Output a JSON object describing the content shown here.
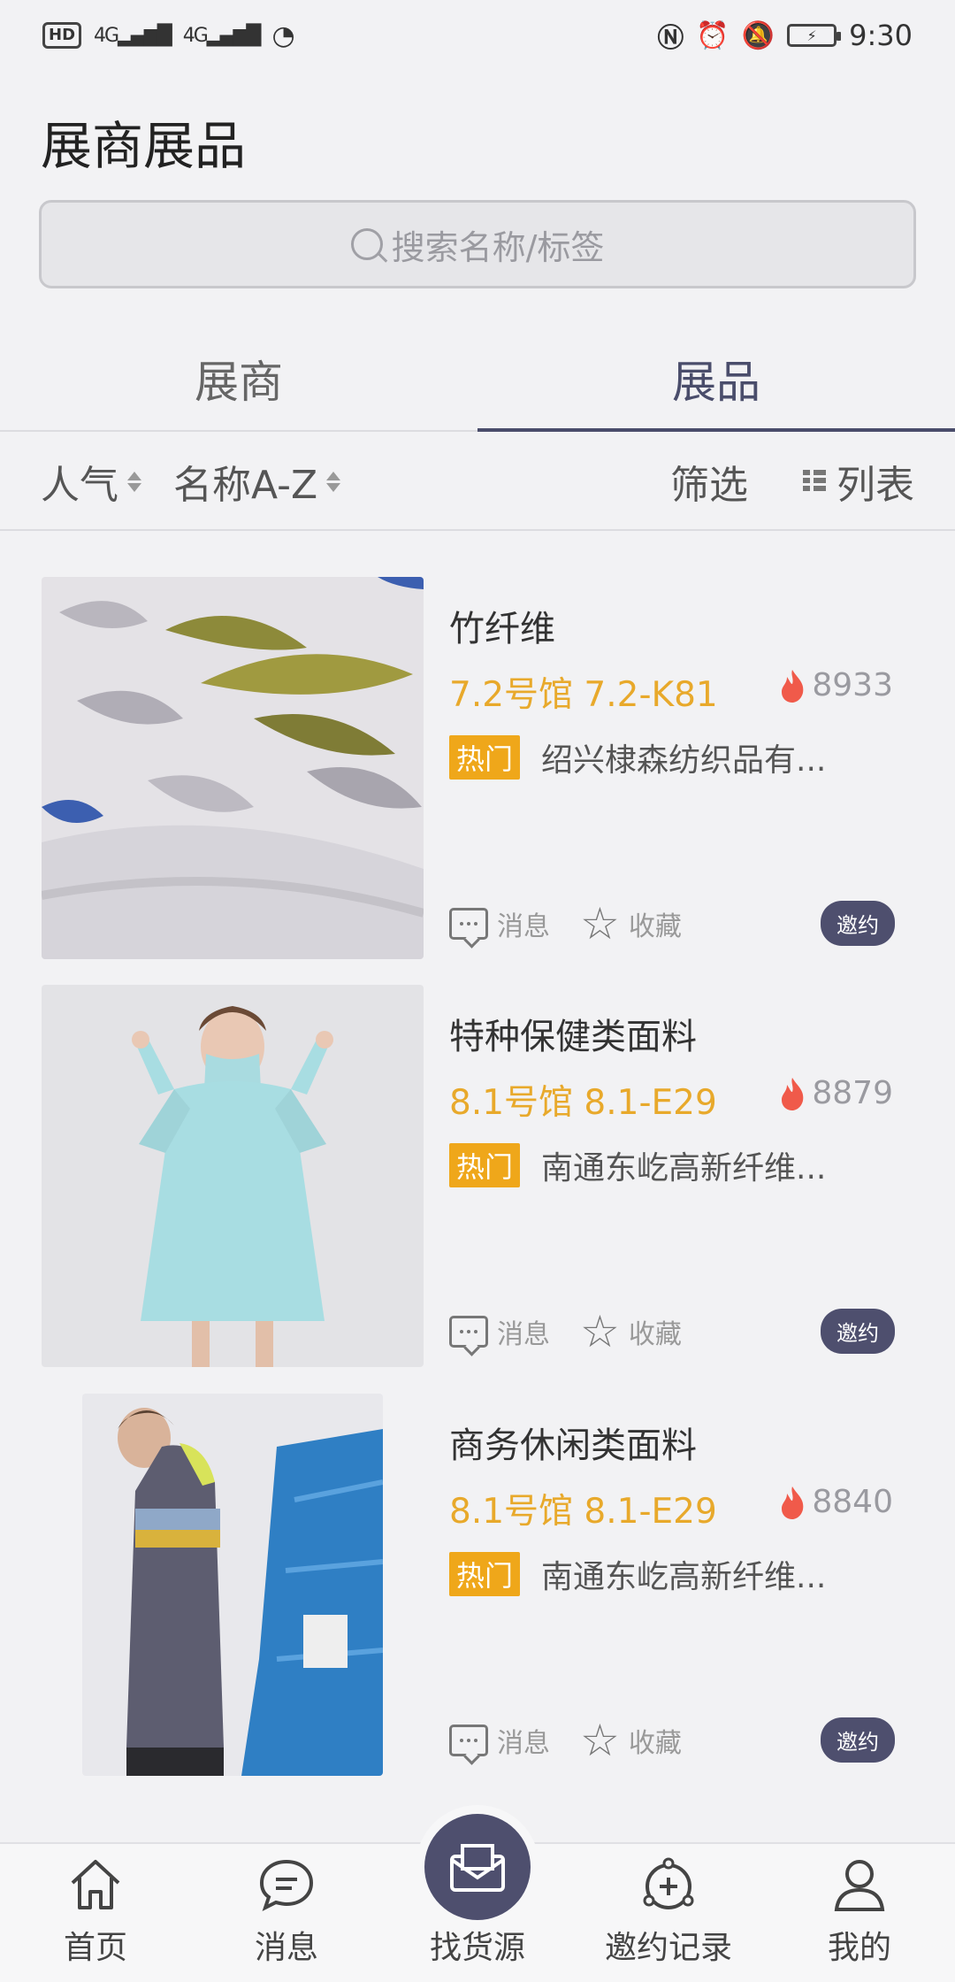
{
  "status_bar": {
    "hd_label": "HD",
    "sim2": "2",
    "net1": "4G",
    "net2": "4G",
    "time": "9:30"
  },
  "header": {
    "title": "展商展品"
  },
  "search": {
    "placeholder": "搜索名称/标签"
  },
  "tabs": [
    {
      "label": "展商",
      "active": false
    },
    {
      "label": "展品",
      "active": true
    }
  ],
  "sort_bar": {
    "popularity": "人气",
    "name_az": "名称A-Z",
    "filter": "筛选",
    "list": "列表"
  },
  "products": [
    {
      "name": "竹纤维",
      "location": "7.2号馆 7.2-K81",
      "heat": "8933",
      "badge": "热门",
      "company": "绍兴棣森纺织品有...",
      "message_label": "消息",
      "favorite_label": "收藏",
      "invite_label": "邀约"
    },
    {
      "name": "特种保健类面料",
      "location": "8.1号馆 8.1-E29",
      "heat": "8879",
      "badge": "热门",
      "company": "南通东屹高新纤维...",
      "message_label": "消息",
      "favorite_label": "收藏",
      "invite_label": "邀约"
    },
    {
      "name": "商务休闲类面料",
      "location": "8.1号馆 8.1-E29",
      "heat": "8840",
      "badge": "热门",
      "company": "南通东屹高新纤维...",
      "message_label": "消息",
      "favorite_label": "收藏",
      "invite_label": "邀约"
    }
  ],
  "bottom_nav": [
    {
      "label": "首页",
      "icon": "home-icon"
    },
    {
      "label": "消息",
      "icon": "chat-icon"
    },
    {
      "label": "找货源",
      "icon": "mail-icon"
    },
    {
      "label": "邀约记录",
      "icon": "invite-record-icon"
    },
    {
      "label": "我的",
      "icon": "user-icon"
    }
  ],
  "colors": {
    "accent": "#4e4f6e",
    "location": "#e8a92b",
    "hot_badge": "#efa71a",
    "flame": "#f05a4a"
  }
}
